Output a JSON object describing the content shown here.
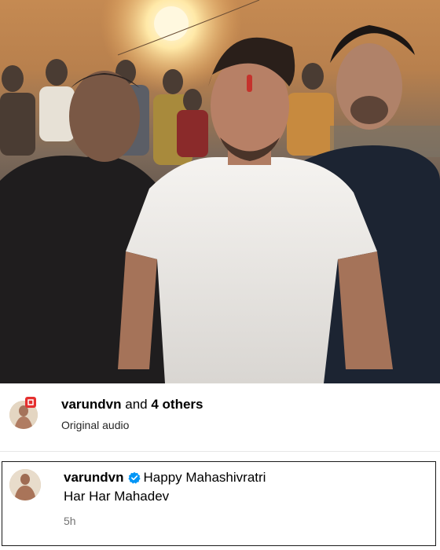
{
  "video": {
    "description_icon": "video-frame-icon"
  },
  "attribution": {
    "username": "varundvn",
    "connector": "and",
    "others": "4 others",
    "audio": "Original audio",
    "badge_color": "#e5302f"
  },
  "comment": {
    "username": "varundvn",
    "verified_icon": "verified-badge-icon",
    "verified_color": "#0095f6",
    "line1": "Happy Mahashivratri",
    "line2": "Har Har Mahadev",
    "time": "5h"
  }
}
